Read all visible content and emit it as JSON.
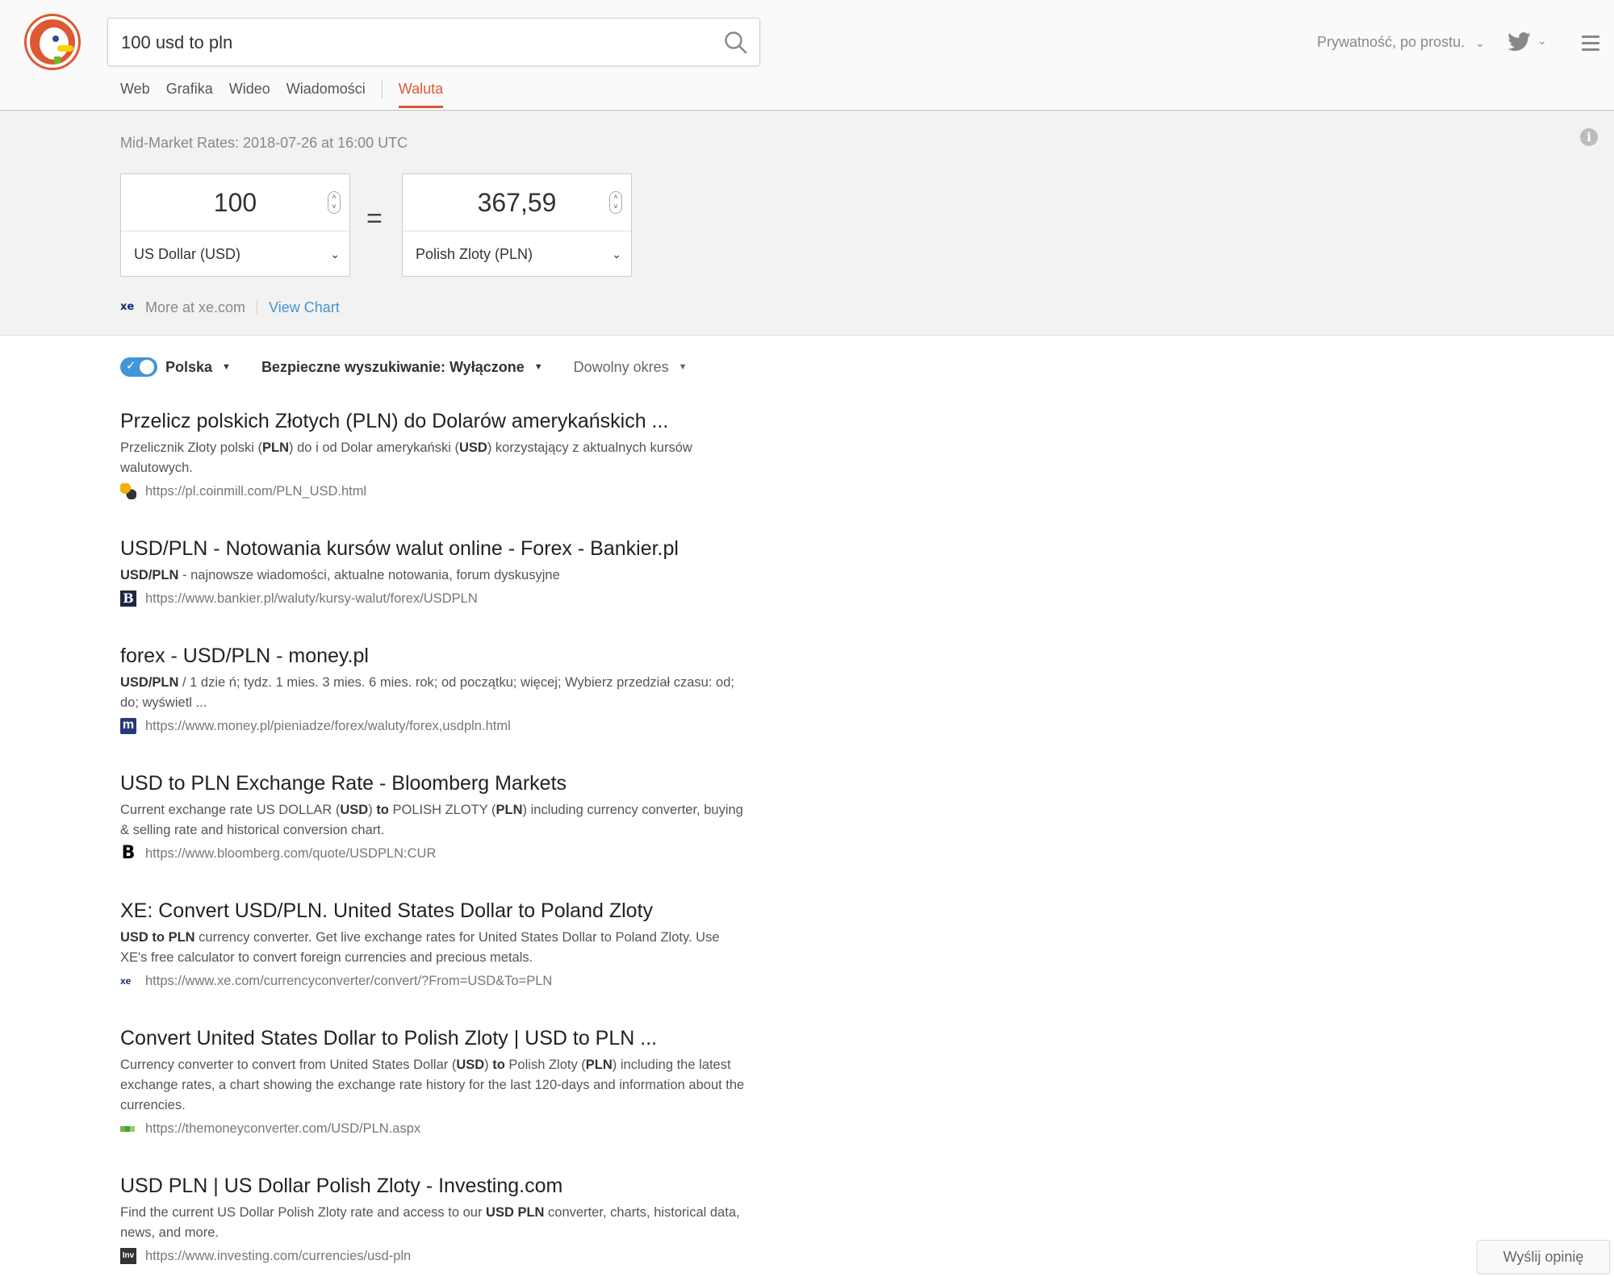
{
  "header": {
    "search_value": "100 usd to pln",
    "privacy_label": "Prywatność, po prostu.",
    "nav": [
      "Web",
      "Grafika",
      "Wideo",
      "Wiadomości",
      "Waluta"
    ],
    "active_tab": "Waluta"
  },
  "currency": {
    "rates_label": "Mid-Market Rates: 2018-07-26 at 16:00 UTC",
    "from_amount": "100",
    "from_currency": "US Dollar (USD)",
    "to_amount": "367,59",
    "to_currency": "Polish Zloty (PLN)",
    "equals": "=",
    "more_label": "More at xe.com",
    "view_chart": "View Chart",
    "xe_logo_text": "xe"
  },
  "filters": {
    "region": "Polska",
    "safe_search": "Bezpieczne wyszukiwanie: Wyłączone",
    "time": "Dowolny okres"
  },
  "results": [
    {
      "title": "Przelicz polskich Złotych (PLN) do Dolarów amerykańskich ...",
      "snippet": "Przelicznik Złoty polski (<b>PLN</b>) do i od Dolar amerykański (<b>USD</b>) korzystający z aktualnych kursów walutowych.",
      "url": "https://pl.coinmill.com/PLN_USD.html",
      "favicon": "coinmill"
    },
    {
      "title": "USD/PLN - Notowania kursów walut online - Forex - Bankier.pl",
      "snippet": "<b>USD/PLN</b> - najnowsze wiadomości, aktualne notowania, forum dyskusyjne",
      "url": "https://www.bankier.pl/waluty/kursy-walut/forex/USDPLN",
      "favicon": "bankier"
    },
    {
      "title": "forex - USD/PLN - money.pl",
      "snippet": "<b>USD/PLN</b> / 1 dzie ń; tydz. 1 mies. 3 mies. 6 mies. rok; od początku; więcej; Wybierz przedział czasu: od; do; wyświetl ...",
      "url": "https://www.money.pl/pieniadze/forex/waluty/forex,usdpln.html",
      "favicon": "money"
    },
    {
      "title": "USD to PLN Exchange Rate - Bloomberg Markets",
      "snippet": "Current exchange rate US DOLLAR (<b>USD</b>) <b>to</b> POLISH ZLOTY (<b>PLN</b>) including currency converter, buying &amp; selling rate and historical conversion chart.",
      "url": "https://www.bloomberg.com/quote/USDPLN:CUR",
      "favicon": "bloomberg"
    },
    {
      "title": "XE: Convert USD/PLN. United States Dollar to Poland Zloty",
      "snippet": "<b>USD to PLN</b> currency converter. Get live exchange rates for United States Dollar to Poland Zloty. Use XE's free calculator to convert foreign currencies and precious metals.",
      "url": "https://www.xe.com/currencyconverter/convert/?From=USD&To=PLN",
      "favicon": "xe"
    },
    {
      "title": "Convert United States Dollar to Polish Zloty | USD to PLN ...",
      "snippet": "Currency converter to convert from United States Dollar (<b>USD</b>) <b>to</b> Polish Zloty (<b>PLN</b>) including the latest exchange rates, a chart showing the exchange rate history for the last 120-days and information about the currencies.",
      "url": "https://themoneyconverter.com/USD/PLN.aspx",
      "favicon": "tmc"
    },
    {
      "title": "USD PLN | US Dollar Polish Zloty - Investing.com",
      "snippet": "Find the current US Dollar Polish Zloty rate and access to our <b>USD PLN</b> converter, charts, historical data, news, and more.",
      "url": "https://www.investing.com/currencies/usd-pln",
      "favicon": "investing"
    }
  ],
  "feedback": "Wyślij opinię",
  "colors": {
    "accent": "#de5833",
    "link": "#4495d4"
  }
}
